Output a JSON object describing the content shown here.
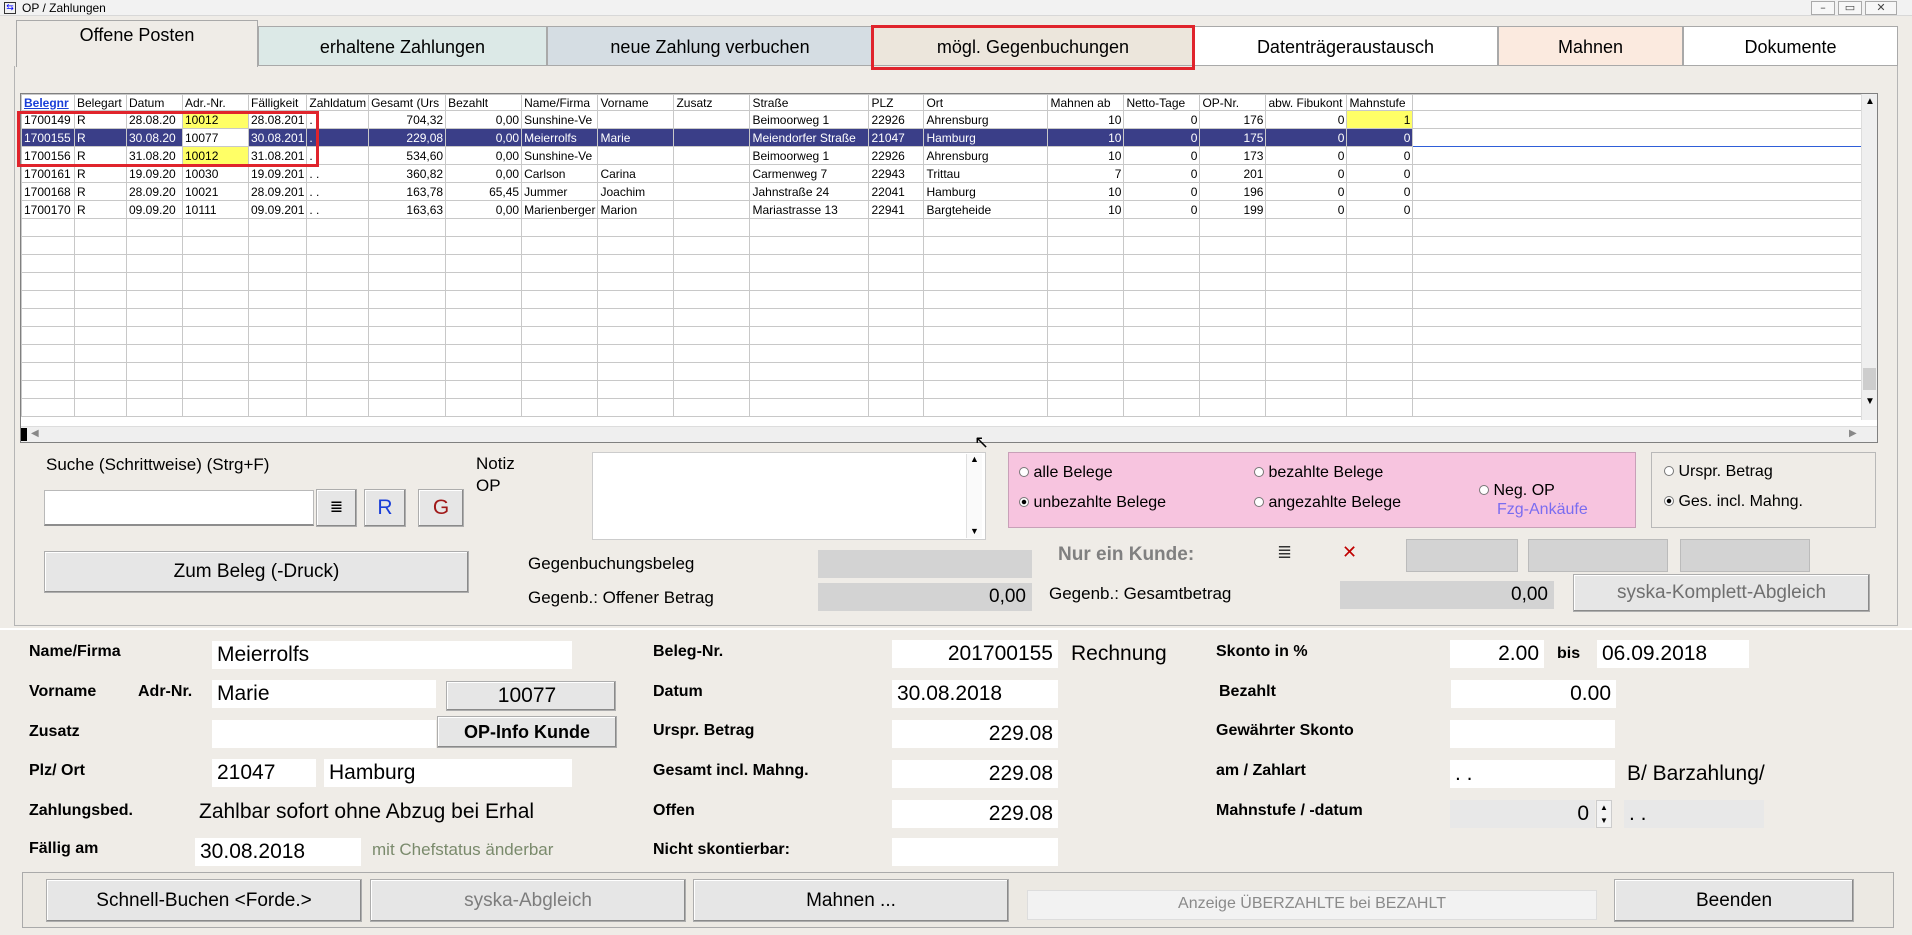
{
  "window": {
    "title": "OP / Zahlungen"
  },
  "tabs": [
    {
      "label": "Offene Posten"
    },
    {
      "label": "erhaltene Zahlungen"
    },
    {
      "label": "neue Zahlung verbuchen"
    },
    {
      "label": "mögl. Gegenbuchungen"
    },
    {
      "label": "Datenträgeraustausch"
    },
    {
      "label": "Mahnen"
    },
    {
      "label": "Dokumente"
    }
  ],
  "grid": {
    "columns": [
      "Belegnr",
      "Belegart",
      "Datum",
      "Adr.-Nr.",
      "Fälligkeit",
      "Zahldatum",
      "Gesamt (Urs",
      "Bezahlt",
      "Name/Firma",
      "Vorname",
      "Zusatz",
      "Straße",
      "PLZ",
      "Ort",
      "Mahnen ab",
      "Netto-Tage",
      "OP-Nr.",
      "abw. Fibukont",
      "Mahnstufe"
    ],
    "rows": [
      [
        "1700149",
        "R",
        "28.08.20",
        "10012",
        "28.08.201",
        ".  .",
        "704,32",
        "0,00",
        "Sunshine-Ve",
        "",
        "",
        "Beimoorweg 1",
        "22926",
        "Ahrensburg",
        "10",
        "0",
        "176",
        "0",
        "1"
      ],
      [
        "1700155",
        "R",
        "30.08.20",
        "10077",
        "30.08.201",
        ".  .",
        "229,08",
        "0,00",
        "Meierrolfs",
        "Marie",
        "",
        "Meiendorfer Straße",
        "21047",
        "Hamburg",
        "10",
        "0",
        "175",
        "0",
        "0"
      ],
      [
        "1700156",
        "R",
        "31.08.20",
        "10012",
        "31.08.201",
        ".  .",
        "534,60",
        "0,00",
        "Sunshine-Ve",
        "",
        "",
        "Beimoorweg 1",
        "22926",
        "Ahrensburg",
        "10",
        "0",
        "173",
        "0",
        "0"
      ],
      [
        "1700161",
        "R",
        "19.09.20",
        "10030",
        "19.09.201",
        ".  .",
        "360,82",
        "0,00",
        "Carlson",
        "Carina",
        "",
        "Carmenweg 7",
        "22943",
        "Trittau",
        "7",
        "0",
        "201",
        "0",
        "0"
      ],
      [
        "1700168",
        "R",
        "28.09.20",
        "10021",
        "28.09.201",
        ".  .",
        "163,78",
        "65,45",
        "Jummer",
        "Joachim",
        "",
        "Jahnstraße 24",
        "22041",
        "Hamburg",
        "10",
        "0",
        "196",
        "0",
        "0"
      ],
      [
        "1700170",
        "R",
        "09.09.20",
        "10111",
        "09.09.201",
        ".  .",
        "163,63",
        "0,00",
        "Marienberger",
        "Marion",
        "",
        "Mariastrasse 13",
        "22941",
        "Bargteheide",
        "10",
        "0",
        "199",
        "0",
        "0"
      ]
    ]
  },
  "search": {
    "label": "Suche (Schrittweise) (Strg+F)",
    "value": "",
    "list_icon": "≣",
    "r_label": "R",
    "g_label": "G"
  },
  "notiz": {
    "label_line1": "Notiz",
    "label_line2": "OP",
    "value": ""
  },
  "filter": {
    "alle": "alle Belege",
    "unbezahlte": "unbezahlte Belege",
    "bezahlte": "bezahlte Belege",
    "angezahlte": "angezahlte Belege",
    "neg_op": "Neg. OP",
    "fzg": "Fzg-Ankäufe",
    "selected": "unbezahlte"
  },
  "amount_mode": {
    "urspr": "Urspr. Betrag",
    "ges": "Ges. incl. Mahng.",
    "selected": "ges"
  },
  "zum_beleg": "Zum Beleg (-Druck)",
  "gegen": {
    "beleg_label": "Gegenbuchungsbeleg",
    "beleg_value": "",
    "offen_label": "Gegenb.: Offener Betrag",
    "offen_value": "0,00",
    "gesamt_label": "Gegenb.: Gesamtbetrag",
    "gesamt_value": "0,00"
  },
  "nur_ein_kunde": {
    "label": "Nur ein Kunde:",
    "list_icon": "≣",
    "clear_icon": "✕"
  },
  "syska_komplett": "syska-Komplett-Abgleich",
  "detail": {
    "name_label": "Name/Firma",
    "name": "Meierrolfs",
    "vorname_label": "Vorname",
    "adr_label": "Adr-Nr.",
    "vorname": "Marie",
    "adr_nr": "10077",
    "zusatz_label": "Zusatz",
    "zusatz": "",
    "op_info": "OP-Info Kunde",
    "plz_label": "Plz/ Ort",
    "plz": "21047",
    "ort": "Hamburg",
    "zahlungsbed_label": "Zahlungsbed.",
    "zahlungsbed": "Zahlbar sofort ohne Abzug bei Erhal",
    "faellig_label": "Fällig am",
    "faellig": "30.08.2018",
    "chefstatus": "mit Chefstatus änderbar",
    "belegnr_label": "Beleg-Nr.",
    "belegnr": "201700155",
    "belegart": "Rechnung",
    "datum_label": "Datum",
    "datum": "30.08.2018",
    "urspr_label": "Urspr. Betrag",
    "urspr": "229.08",
    "gesamt_label": "Gesamt incl. Mahng.",
    "gesamt": "229.08",
    "offen_label": "Offen",
    "offen": "229.08",
    "nicht_skonto_label": "Nicht skontierbar:",
    "nicht_skonto": "",
    "skonto_label": "Skonto in %",
    "skonto": "2.00",
    "bis_label": "bis",
    "bis": "06.09.2018",
    "bezahlt_label": "Bezahlt",
    "bezahlt": "0.00",
    "gew_skonto_label": "Gewährter Skonto",
    "gew_skonto": "",
    "am_zahlart_label": "am / Zahlart",
    "am": ".  .",
    "zahlart": "B/  Barzahlung/",
    "mahnstufe_label": "Mahnstufe / -datum",
    "mahnstufe": "0",
    "mahndatum": ".  ."
  },
  "bottom": {
    "schnell": "Schnell-Buchen <Forde.>",
    "syska": "syska-Abgleich",
    "mahnen": "Mahnen ...",
    "anzeige": "Anzeige ÜBERZAHLTE bei BEZAHLT",
    "beenden": "Beenden"
  }
}
